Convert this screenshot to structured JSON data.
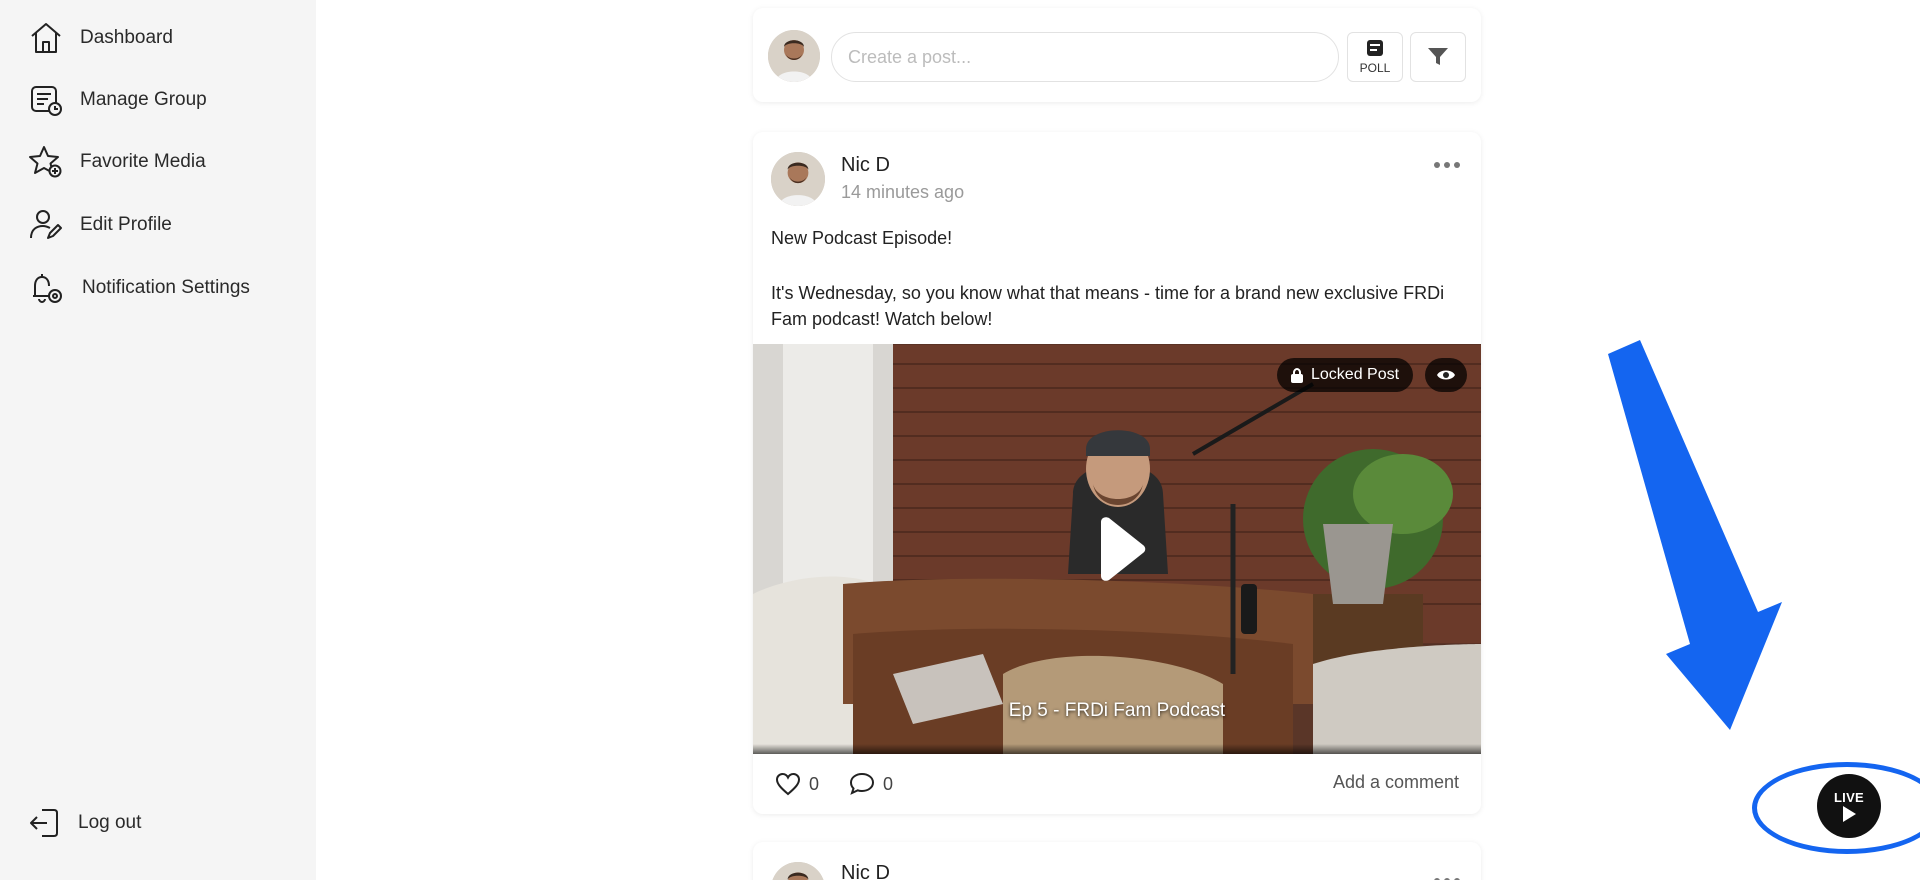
{
  "sidebar": {
    "items": [
      {
        "label": "Dashboard",
        "icon": "home-icon"
      },
      {
        "label": "Manage Group",
        "icon": "manage-group-icon"
      },
      {
        "label": "Favorite Media",
        "icon": "star-icon"
      },
      {
        "label": "Edit Profile",
        "icon": "edit-profile-icon"
      },
      {
        "label": "Notification Settings",
        "icon": "bell-settings-icon"
      }
    ],
    "logout_label": "Log out"
  },
  "composer": {
    "placeholder": "Create a post...",
    "poll_label": "POLL"
  },
  "post": {
    "author": "Nic D",
    "time": "14 minutes ago",
    "title": "New Podcast Episode!",
    "body": "It's Wednesday, so you know what that means - time for a brand new exclusive FRDi Fam podcast! Watch below!",
    "locked_label": "Locked Post",
    "video_caption": "Ep 5 - FRDi Fam Podcast",
    "likes": "0",
    "comments": "0",
    "add_comment": "Add a comment"
  },
  "post2": {
    "author": "Nic D"
  },
  "live": {
    "label": "LIVE"
  },
  "colors": {
    "annotation": "#1465f0",
    "sidebar_bg": "#f5f5f5"
  }
}
